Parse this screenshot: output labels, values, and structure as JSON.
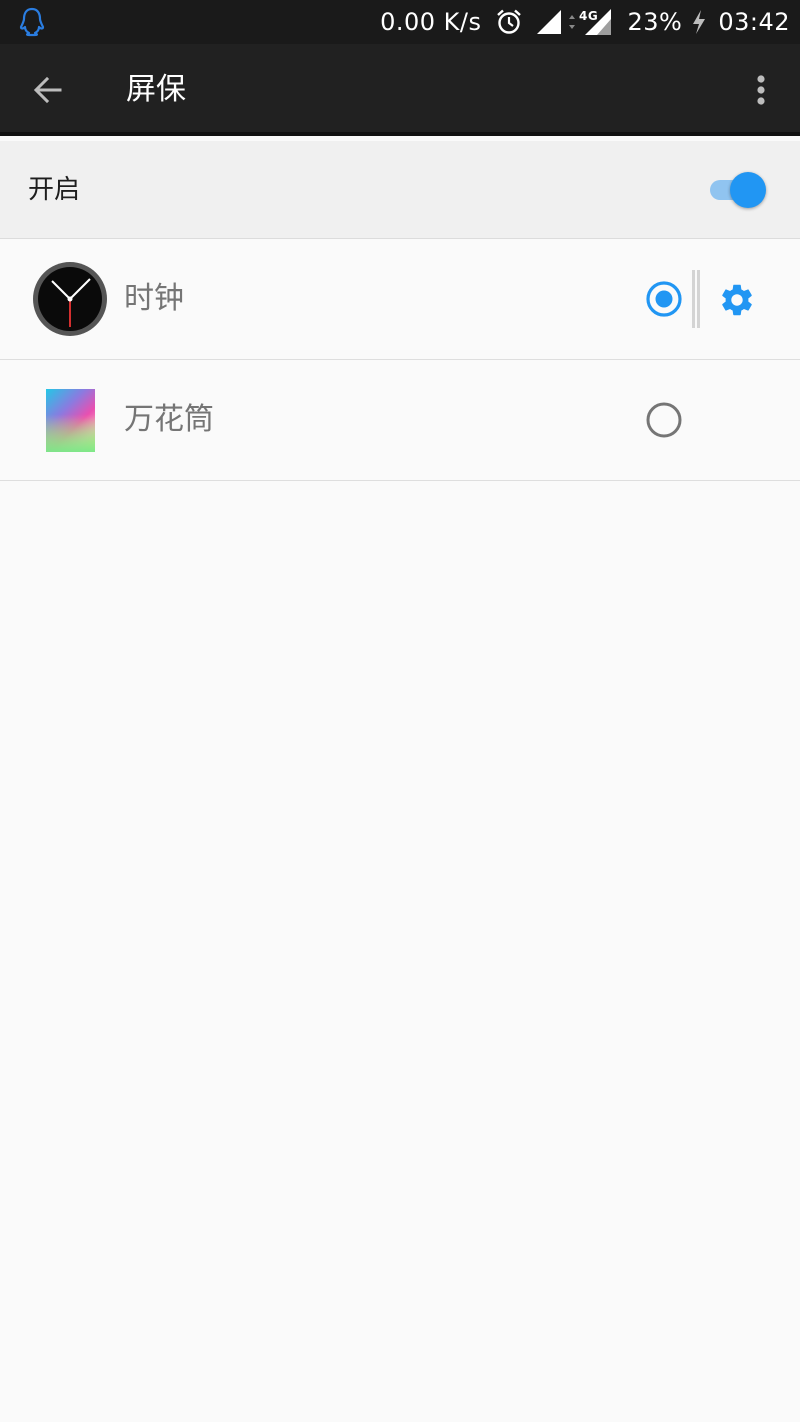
{
  "status_bar": {
    "net_speed": "0.00 K/s",
    "network_type": "4G",
    "battery": "23%",
    "time": "03:42",
    "icons": [
      "qq-icon",
      "alarm-icon",
      "signal-icon",
      "data-arrows-icon",
      "signal-4g-icon",
      "charging-icon"
    ]
  },
  "app_bar": {
    "title": "屏保",
    "back_icon": "back-arrow-icon",
    "menu_icon": "more-vert-icon"
  },
  "enable": {
    "label": "开启",
    "on": true
  },
  "options": [
    {
      "label": "时钟",
      "selected": true,
      "icon": "clock-icon",
      "settings_icon": "gear-icon"
    },
    {
      "label": "万花筒",
      "selected": false,
      "icon": "kaleidoscope-icon"
    }
  ],
  "colors": {
    "accent": "#2196f3",
    "app_bar": "#212121",
    "status_bar": "#1a1a1a",
    "background": "#fafafa",
    "header_row": "#f0f0f0",
    "option_text": "#757575"
  }
}
